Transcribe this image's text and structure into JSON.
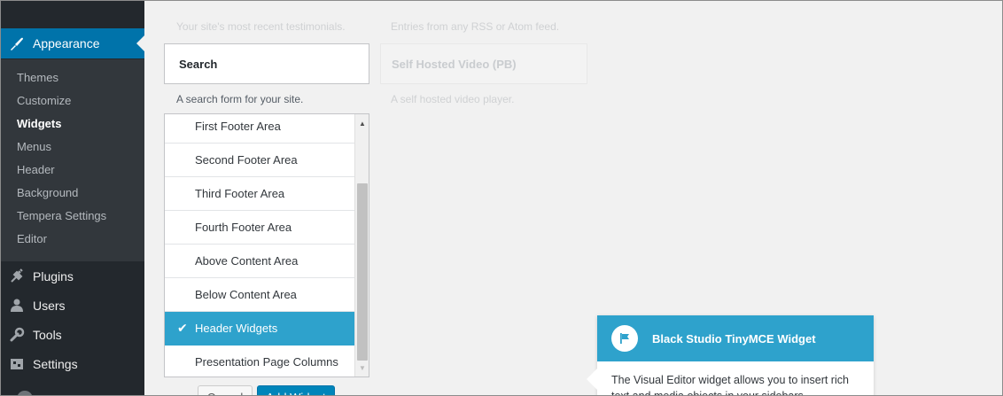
{
  "sidebar": {
    "current": {
      "label": "Appearance",
      "icon": "paintbrush-icon"
    },
    "submenu": [
      "Themes",
      "Customize",
      "Widgets",
      "Menus",
      "Header",
      "Background",
      "Tempera Settings",
      "Editor"
    ],
    "active_submenu": "Widgets",
    "items": [
      {
        "label": "Plugins",
        "icon": "plugins-icon"
      },
      {
        "label": "Users",
        "icon": "users-icon"
      },
      {
        "label": "Tools",
        "icon": "tools-icon"
      },
      {
        "label": "Settings",
        "icon": "settings-icon"
      }
    ]
  },
  "widgets": {
    "faded_desc_left": "Your site's most recent testimonials.",
    "faded_desc_right": "Entries from any RSS or Atom feed.",
    "faded_widget_title": "Self Hosted Video (PB)",
    "faded_widget_desc": "A self hosted video player.",
    "search_title": "Search",
    "search_desc": "A search form for your site."
  },
  "areas": {
    "items": [
      "First Footer Area",
      "Second Footer Area",
      "Third Footer Area",
      "Fourth Footer Area",
      "Above Content Area",
      "Below Content Area",
      "Header Widgets",
      "Presentation Page Columns"
    ],
    "selected": "Header Widgets"
  },
  "actions": {
    "cancel": "Cancel",
    "add": "Add Widget"
  },
  "pointer": {
    "title": "Black Studio TinyMCE Widget",
    "body": "The Visual Editor widget allows you to insert rich text and media objects in your sidebars"
  },
  "colors": {
    "sidebar_bg": "#23282d",
    "submenu_bg": "#32373c",
    "current_menu": "#0073aa",
    "selected_area": "#2ea2cc",
    "pointer_header": "#2ea2cc"
  }
}
